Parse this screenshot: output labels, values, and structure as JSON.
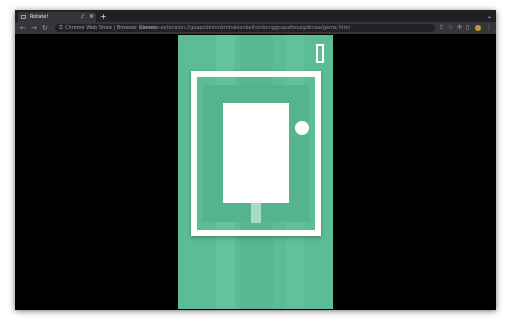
{
  "browser": {
    "tab": {
      "title": "Rotate!",
      "audio_icon": "speaker-icon",
      "close_icon": "close-icon"
    },
    "new_tab_icon": "plus-icon",
    "tab_search_icon": "chevron-down-icon",
    "site_name": "Chrome Web Store | Browser Games",
    "url": "chrome-extension://goapcbkmmkmhaklonkeihonbnnggcapafooalgdknae/game.html",
    "toolbar_icons": [
      "share-icon",
      "star-icon",
      "extensions-icon",
      "sidebar-icon",
      "profile-icon",
      "menu-icon"
    ]
  },
  "glyphs": {
    "tab_audio": "♪",
    "tab_close": "×",
    "new_tab": "+",
    "tab_search": "⌄",
    "back": "←",
    "forward": "→",
    "reload": "↻",
    "lock": "⚿",
    "share": "⇪",
    "star": "☆",
    "extensions": "✣",
    "sidebar": "▯",
    "menu": "⋮"
  },
  "game": {
    "background_color": "#5cbc95",
    "pause_icon": "pause-icon"
  }
}
